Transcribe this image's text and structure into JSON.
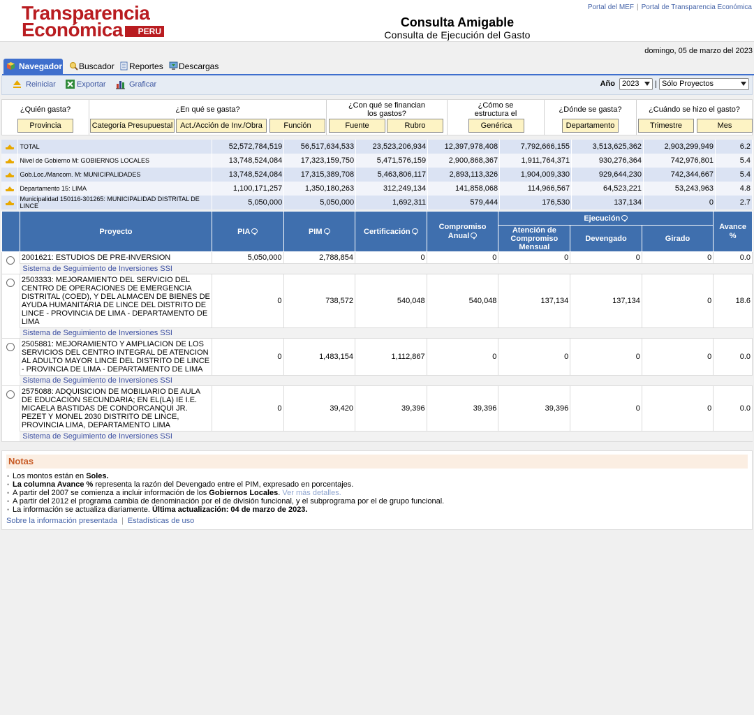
{
  "brand": {
    "line1": "Transparencia",
    "line2": "Económica",
    "tag": "PERU"
  },
  "title": {
    "main": "Consulta Amigable",
    "sub": "Consulta de Ejecución del Gasto"
  },
  "top_links": [
    "Portal del MEF",
    "Portal de Transparencia Económica"
  ],
  "date": "domingo, 05 de marzo del 2023",
  "tabs": [
    "Navegador",
    "Buscador",
    "Reportes",
    "Descargas"
  ],
  "toolbar": {
    "reset": "Reiniciar",
    "export": "Exportar",
    "chart": "Graficar",
    "year_label": "Año",
    "year_value": "2023",
    "sep": "|",
    "mode_value": "Sólo Proyectos"
  },
  "questions": {
    "who": "¿Quién gasta?",
    "what": "¿En qué se gasta?",
    "financing": "¿Con qué se financian los gastos?",
    "structure": "¿Cómo se estructura el gasto?",
    "where": "¿Dónde se gasta?",
    "when": "¿Cuándo se hizo el gasto?"
  },
  "buttons": {
    "provincia": "Provincia",
    "categoria": "Categoría Presupuestal",
    "actividad": "Act./Acción de Inv./Obra",
    "funcion": "Función",
    "fuente": "Fuente",
    "rubro": "Rubro",
    "generica": "Genérica",
    "departamento": "Departamento",
    "trimestre": "Trimestre",
    "mes": "Mes"
  },
  "summary": [
    {
      "label": "TOTAL",
      "pia": "52,572,784,519",
      "pim": "56,517,634,533",
      "cert": "23,523,206,934",
      "comp": "12,397,978,408",
      "aten": "7,792,666,155",
      "dev": "3,513,625,362",
      "gir": "2,903,299,949",
      "av": "6.2"
    },
    {
      "label": "Nivel de Gobierno M: GOBIERNOS LOCALES",
      "pia": "13,748,524,084",
      "pim": "17,323,159,750",
      "cert": "5,471,576,159",
      "comp": "2,900,868,367",
      "aten": "1,911,764,371",
      "dev": "930,276,364",
      "gir": "742,976,801",
      "av": "5.4"
    },
    {
      "label": "Gob.Loc./Mancom. M: MUNICIPALIDADES",
      "pia": "13,748,524,084",
      "pim": "17,315,389,708",
      "cert": "5,463,806,117",
      "comp": "2,893,113,326",
      "aten": "1,904,009,330",
      "dev": "929,644,230",
      "gir": "742,344,667",
      "av": "5.4"
    },
    {
      "label": "Departamento 15: LIMA",
      "pia": "1,100,171,257",
      "pim": "1,350,180,263",
      "cert": "312,249,134",
      "comp": "141,858,068",
      "aten": "114,966,567",
      "dev": "64,523,221",
      "gir": "53,243,963",
      "av": "4.8"
    },
    {
      "label": "Municipalidad 150116-301265: MUNICIPALIDAD DISTRITAL DE LINCE",
      "pia": "5,050,000",
      "pim": "5,050,000",
      "cert": "1,692,311",
      "comp": "579,444",
      "aten": "176,530",
      "dev": "137,134",
      "gir": "0",
      "av": "2.7"
    }
  ],
  "table_headers": {
    "proyecto": "Proyecto",
    "pia": "PIA",
    "pim": "PIM",
    "cert": "Certificación",
    "comp": "Compromiso Anual",
    "ejec": "Ejecución",
    "aten": "Atención de Compromiso Mensual",
    "dev": "Devengado",
    "gir": "Girado",
    "av": "Avance %"
  },
  "projects": [
    {
      "name": "2001621: ESTUDIOS DE PRE-INVERSION",
      "pia": "5,050,000",
      "pim": "2,788,854",
      "cert": "0",
      "comp": "0",
      "aten": "0",
      "dev": "0",
      "gir": "0",
      "av": "0.0",
      "ssi": "Sistema de Seguimiento de Inversiones SSI"
    },
    {
      "name": "2503333: MEJORAMIENTO DEL SERVICIO DEL CENTRO DE OPERACIONES DE EMERGENCIA DISTRITAL (COED), Y DEL ALMACEN DE BIENES DE AYUDA HUMANITARIA DE LINCE DEL DISTRITO DE LINCE - PROVINCIA DE LIMA - DEPARTAMENTO DE LIMA",
      "pia": "0",
      "pim": "738,572",
      "cert": "540,048",
      "comp": "540,048",
      "aten": "137,134",
      "dev": "137,134",
      "gir": "0",
      "av": "18.6",
      "ssi": "Sistema de Seguimiento de Inversiones SSI"
    },
    {
      "name": "2505881: MEJORAMIENTO Y AMPLIACION DE LOS SERVICIOS DEL CENTRO INTEGRAL DE ATENCION AL ADULTO MAYOR LINCE DEL DISTRITO DE LINCE - PROVINCIA DE LIMA - DEPARTAMENTO DE LIMA",
      "pia": "0",
      "pim": "1,483,154",
      "cert": "1,112,867",
      "comp": "0",
      "aten": "0",
      "dev": "0",
      "gir": "0",
      "av": "0.0",
      "ssi": "Sistema de Seguimiento de Inversiones SSI"
    },
    {
      "name": "2575088: ADQUISICION DE MOBILIARIO DE AULA DE EDUCACION SECUNDARIA; EN EL(LA) IE I.E. MICAELA BASTIDAS DE CONDORCANQUI JR. PEZET Y MONEL 2030 DISTRITO DE LINCE, PROVINCIA LIMA, DEPARTAMENTO LIMA",
      "pia": "0",
      "pim": "39,420",
      "cert": "39,396",
      "comp": "39,396",
      "aten": "39,396",
      "dev": "0",
      "gir": "0",
      "av": "0.0",
      "ssi": "Sistema de Seguimiento de Inversiones SSI"
    }
  ],
  "notes": {
    "title": "Notas",
    "n1_a": "Los montos están en ",
    "n1_b": "Soles.",
    "n2_a": "La columna Avance %",
    "n2_b": " representa la razón del Devengado entre el PIM, expresado en porcentajes.",
    "n3_a": "A partir del 2007 se comienza a incluir información de los ",
    "n3_b": "Gobiernos Locales",
    "n3_c": ". ",
    "n3_link": "Ver más detalles.",
    "n4": "A partir del 2012 el programa cambia de denominación por el de división funcional, y el subprograma por el de grupo funcional.",
    "n5_a": "La información se actualiza diariamente. ",
    "n5_b": "Última actualización: 04 de marzo de 2023.",
    "footer_links": [
      "Sobre la información presentada",
      "Estadísticas de uso"
    ]
  }
}
